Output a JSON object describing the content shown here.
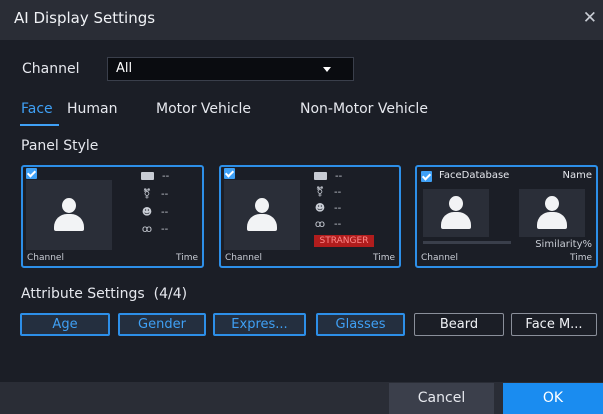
{
  "dialog": {
    "title": "AI Display Settings"
  },
  "channel": {
    "label": "Channel",
    "value": "All"
  },
  "tabs": [
    {
      "label": "Face",
      "active": true
    },
    {
      "label": "Human",
      "active": false
    },
    {
      "label": "Motor Vehicle",
      "active": false
    },
    {
      "label": "Non-Motor Vehicle",
      "active": false
    }
  ],
  "panel_style": {
    "heading": "Panel Style",
    "card1": {
      "channel": "Channel",
      "time": "Time",
      "checked": true,
      "attrs": [
        "--",
        "--",
        "--",
        "--"
      ]
    },
    "card2": {
      "channel": "Channel",
      "time": "Time",
      "checked": true,
      "attrs": [
        "--",
        "--",
        "--",
        "--"
      ],
      "tag": "STRANGER"
    },
    "card3": {
      "checked": true,
      "face_database": "FaceDatabase",
      "name": "Name",
      "similarity": "Similarity%",
      "channel": "Channel",
      "time": "Time"
    }
  },
  "attribute_settings": {
    "heading": "Attribute Settings",
    "count": "(4/4)",
    "chips": [
      {
        "label": "Age",
        "selected": true
      },
      {
        "label": "Gender",
        "selected": true
      },
      {
        "label": "Expres...",
        "selected": true
      },
      {
        "label": "Glasses",
        "selected": true
      },
      {
        "label": "Beard",
        "selected": false
      },
      {
        "label": "Face M...",
        "selected": false
      }
    ]
  },
  "buttons": {
    "cancel": "Cancel",
    "ok": "OK"
  },
  "colors": {
    "accent": "#2d8fe8",
    "background": "#1b1e26",
    "stranger": "#b11d1d"
  }
}
